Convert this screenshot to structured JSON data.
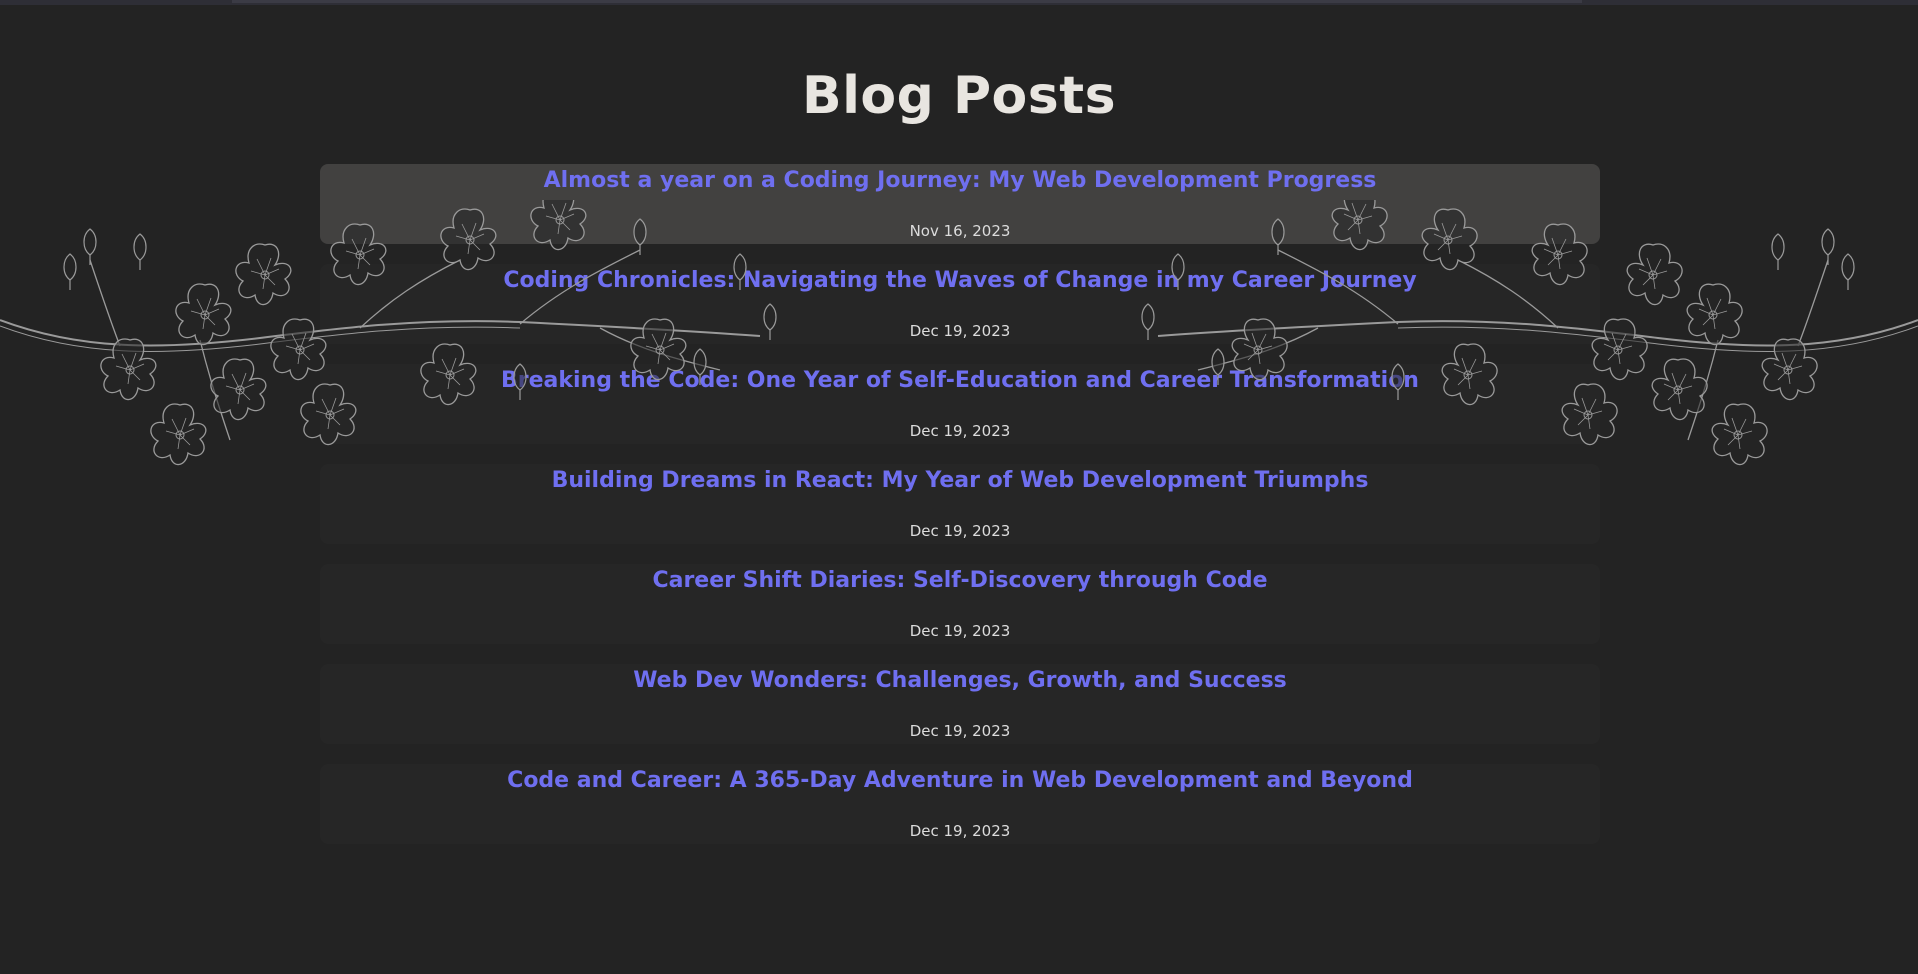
{
  "page": {
    "title": "Blog Posts"
  },
  "posts": [
    {
      "title": "Almost a year on a Coding Journey: My Web Development Progress",
      "date": "Nov 16, 2023"
    },
    {
      "title": "Coding Chronicles: Navigating the Waves of Change in my Career Journey",
      "date": "Dec 19, 2023"
    },
    {
      "title": "Breaking the Code: One Year of Self-Education and Career Transformation",
      "date": "Dec 19, 2023"
    },
    {
      "title": "Building Dreams in React: My Year of Web Development Triumphs",
      "date": "Dec 19, 2023"
    },
    {
      "title": "Career Shift Diaries: Self-Discovery through Code",
      "date": "Dec 19, 2023"
    },
    {
      "title": "Web Dev Wonders: Challenges, Growth, and Success",
      "date": "Dec 19, 2023"
    },
    {
      "title": "Code and Career: A 365-Day Adventure in Web Development and Beyond",
      "date": "Dec 19, 2023"
    }
  ],
  "colors": {
    "background": "#232323",
    "link": "#6f6ff0",
    "heading": "#e8e5e0",
    "active_card": "#424140",
    "card": "#262626"
  },
  "decor": {
    "icon": "cherry-blossom-branch-line-art"
  }
}
